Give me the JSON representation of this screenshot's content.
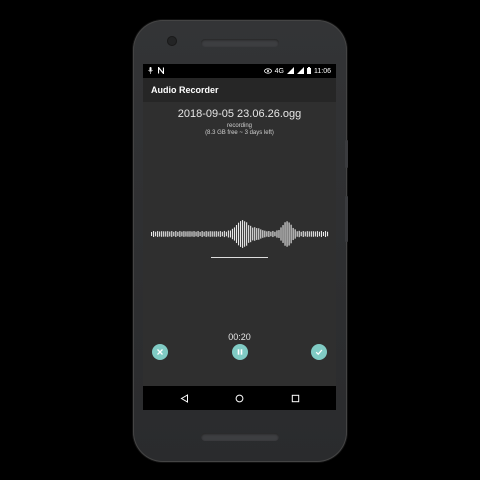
{
  "status_bar": {
    "network_label": "4G",
    "time": "11:06",
    "icons": [
      "mic-icon",
      "notification-n-icon",
      "eye-icon",
      "signal-icon",
      "wifi-icon",
      "battery-icon"
    ]
  },
  "app": {
    "title": "Audio Recorder"
  },
  "recording": {
    "filename": "2018-09-05 23.06.26.ogg",
    "state": "recording",
    "storage_info": "(8.3 GB free ~ 3 days left)",
    "timer": "00:20"
  },
  "controls": {
    "cancel_icon": "close-icon",
    "pause_icon": "pause-icon",
    "done_icon": "check-icon",
    "accent": "#80cbc4"
  },
  "nav": {
    "icons": [
      "back-icon",
      "home-icon",
      "recents-icon"
    ]
  }
}
